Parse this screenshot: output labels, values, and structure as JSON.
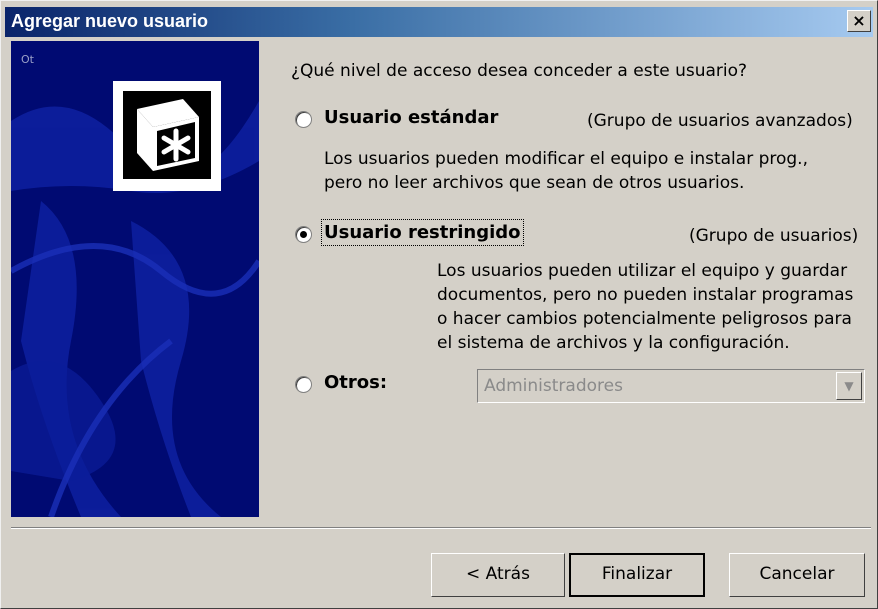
{
  "window": {
    "title": "Agregar nuevo usuario",
    "close_label": "×"
  },
  "banner": {
    "corner_label": "Ot"
  },
  "question": "¿Qué nivel de acceso desea conceder a este usuario?",
  "options": [
    {
      "label": "Usuario estándar",
      "group": "(Grupo de usuarios avanzados)",
      "selected": false,
      "description": [
        "Los usuarios pueden modificar el equipo e instalar prog.,",
        "pero no leer archivos que sean de otros usuarios."
      ]
    },
    {
      "label": "Usuario restringido",
      "group": "(Grupo de usuarios)",
      "selected": true,
      "description": [
        "Los usuarios pueden utilizar el equipo y guardar",
        "documentos, pero no pueden instalar programas",
        "o hacer cambios potencialmente peligrosos para",
        "el sistema de archivos y la configuración."
      ]
    },
    {
      "label": "Otros:",
      "selected": false,
      "combo_value": "Administradores",
      "combo_enabled": false
    }
  ],
  "buttons": {
    "back": "< Atrás",
    "finish": "Finalizar",
    "cancel": "Cancelar"
  },
  "colors": {
    "banner_bg": "#000a72",
    "title_bar": "#0a246a",
    "face": "#d4d0c8"
  },
  "icons": {
    "close": "close-icon",
    "banner_icon": "asterisk-key-icon",
    "combo_arrow": "chevron-down-icon"
  }
}
